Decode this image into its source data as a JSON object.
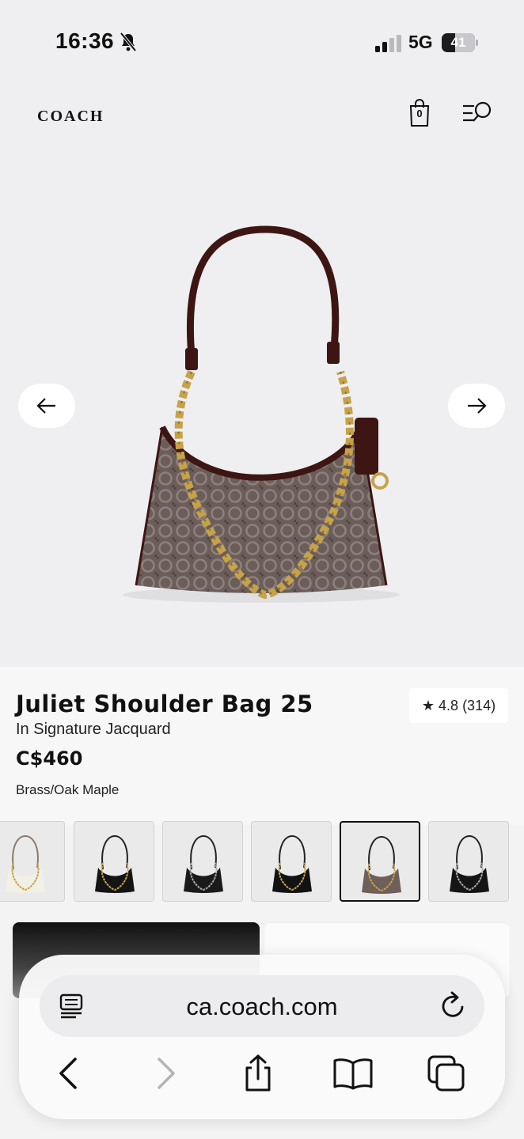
{
  "status_bar": {
    "time": "16:36",
    "network": "5G",
    "battery": "41",
    "battery_level": 0.41
  },
  "header": {
    "logo": "COACH",
    "bag_count": "0"
  },
  "product": {
    "title": "Juliet Shoulder Bag 25",
    "subtitle": "In Signature Jacquard",
    "price": "C$460",
    "color": "Brass/Oak Maple",
    "rating": "4.8",
    "review_count": "(314)"
  },
  "swatches": [
    {
      "name": "chalk",
      "color": "#f2efe6"
    },
    {
      "name": "black-gold",
      "color": "#141414"
    },
    {
      "name": "black-silver",
      "color": "#1a1a1a"
    },
    {
      "name": "black-leather",
      "color": "#121212"
    },
    {
      "name": "brass-oak-maple",
      "color": "#6e5f5a",
      "selected": true
    },
    {
      "name": "black-silver-chain",
      "color": "#151515"
    }
  ],
  "browser": {
    "url": "ca.coach.com"
  },
  "colors": {
    "accent": "#111111",
    "background": "#efeff1",
    "bag_body": "#6b5d5a",
    "chain": "#c6a24a",
    "strap": "#3d1614"
  }
}
